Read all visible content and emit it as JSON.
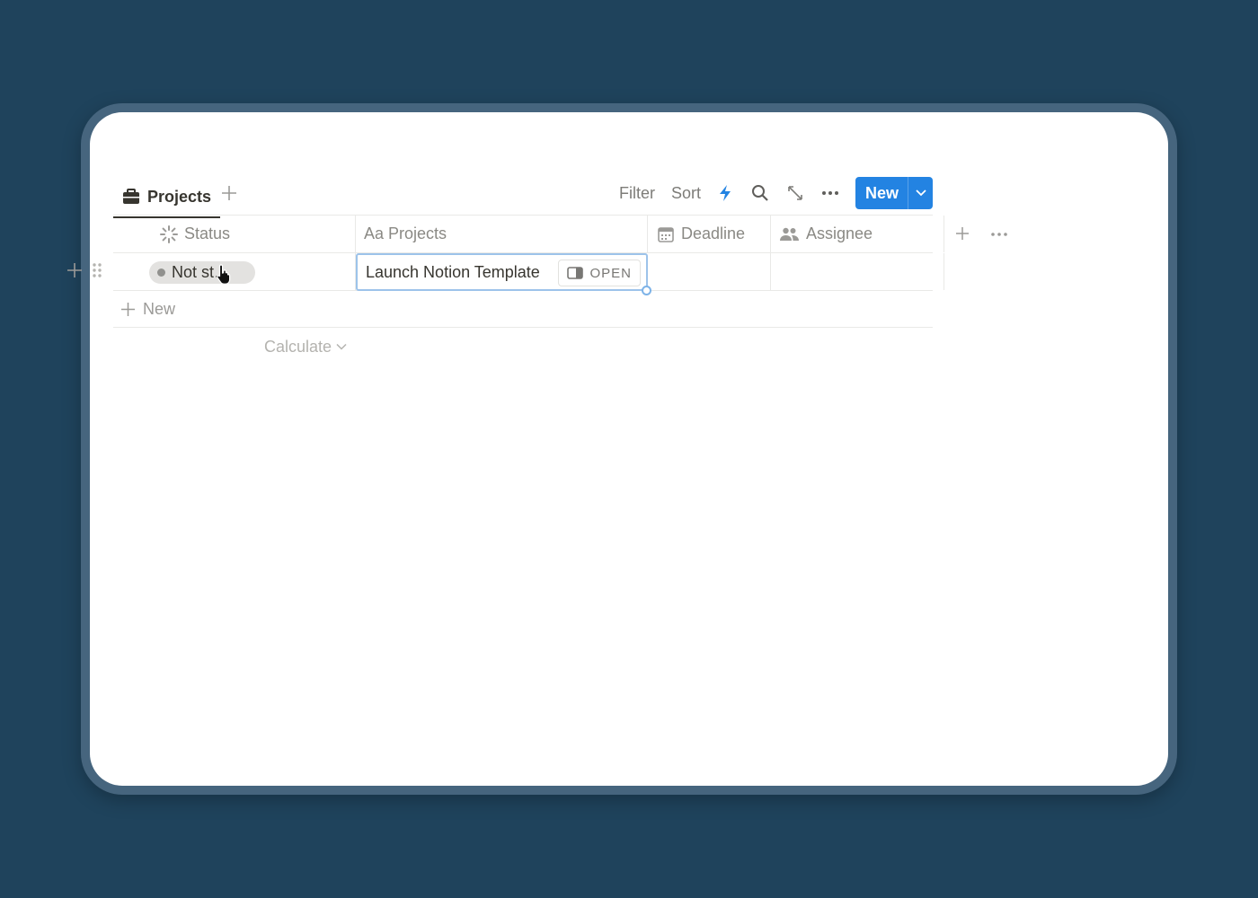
{
  "toolbar": {
    "tab_label": "Projects",
    "filter_label": "Filter",
    "sort_label": "Sort",
    "new_label": "New"
  },
  "columns": [
    {
      "icon": "status-icon",
      "label": "Status"
    },
    {
      "icon": "text-icon",
      "label": "Projects",
      "prefix": "Aa"
    },
    {
      "icon": "calendar-icon",
      "label": "Deadline"
    },
    {
      "icon": "people-icon",
      "label": "Assignee"
    }
  ],
  "rows": [
    {
      "status": "Not st…",
      "title": "Launch Notion Template",
      "deadline": "",
      "assignee": ""
    }
  ],
  "open_label": "OPEN",
  "new_row_label": "New",
  "calculate_label": "Calculate",
  "colors": {
    "background": "#1f435c",
    "accent": "#2383e2",
    "selection": "#9dc3ea"
  }
}
